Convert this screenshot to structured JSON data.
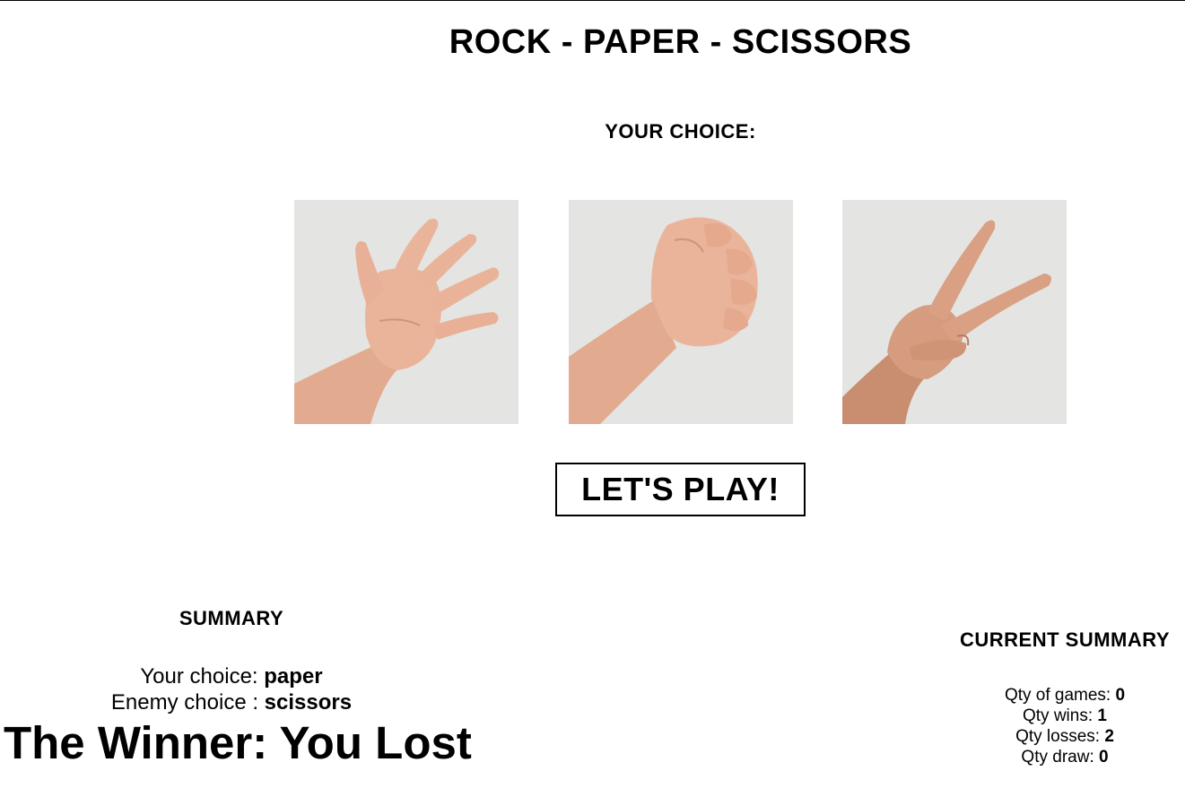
{
  "title": {
    "part1": "ROCK",
    "sep1": " - ",
    "part2": "PAPER",
    "sep2": " - ",
    "part3": "SCISSORS"
  },
  "choice_heading": "YOUR CHOICE:",
  "choices": [
    {
      "value": "paper",
      "icon": "open-hand-paper-icon"
    },
    {
      "value": "rock",
      "icon": "fist-rock-icon"
    },
    {
      "value": "scissors",
      "icon": "v-sign-scissors-icon"
    }
  ],
  "play_button": "LET'S PLAY!",
  "summary": {
    "heading": "SUMMARY",
    "your_label": "Your choice: ",
    "your_value": "paper",
    "enemy_label": "Enemy choice : ",
    "enemy_value": "scissors",
    "winner_label": "The Winner: ",
    "winner_value": "You Lost"
  },
  "current_summary": {
    "heading": "CURRENT SUMMARY",
    "games_label": "Qty of games: ",
    "games_value": "0",
    "wins_label": "Qty wins: ",
    "wins_value": "1",
    "losses_label": "Qty losses: ",
    "losses_value": "2",
    "draw_label": "Qty draw: ",
    "draw_value": "0"
  },
  "colors": {
    "background": "#ffffff",
    "photo_background": "#e4e4e2",
    "skin": "#e9b49a",
    "skin_shadow": "#d39a7e",
    "text": "#000000"
  }
}
